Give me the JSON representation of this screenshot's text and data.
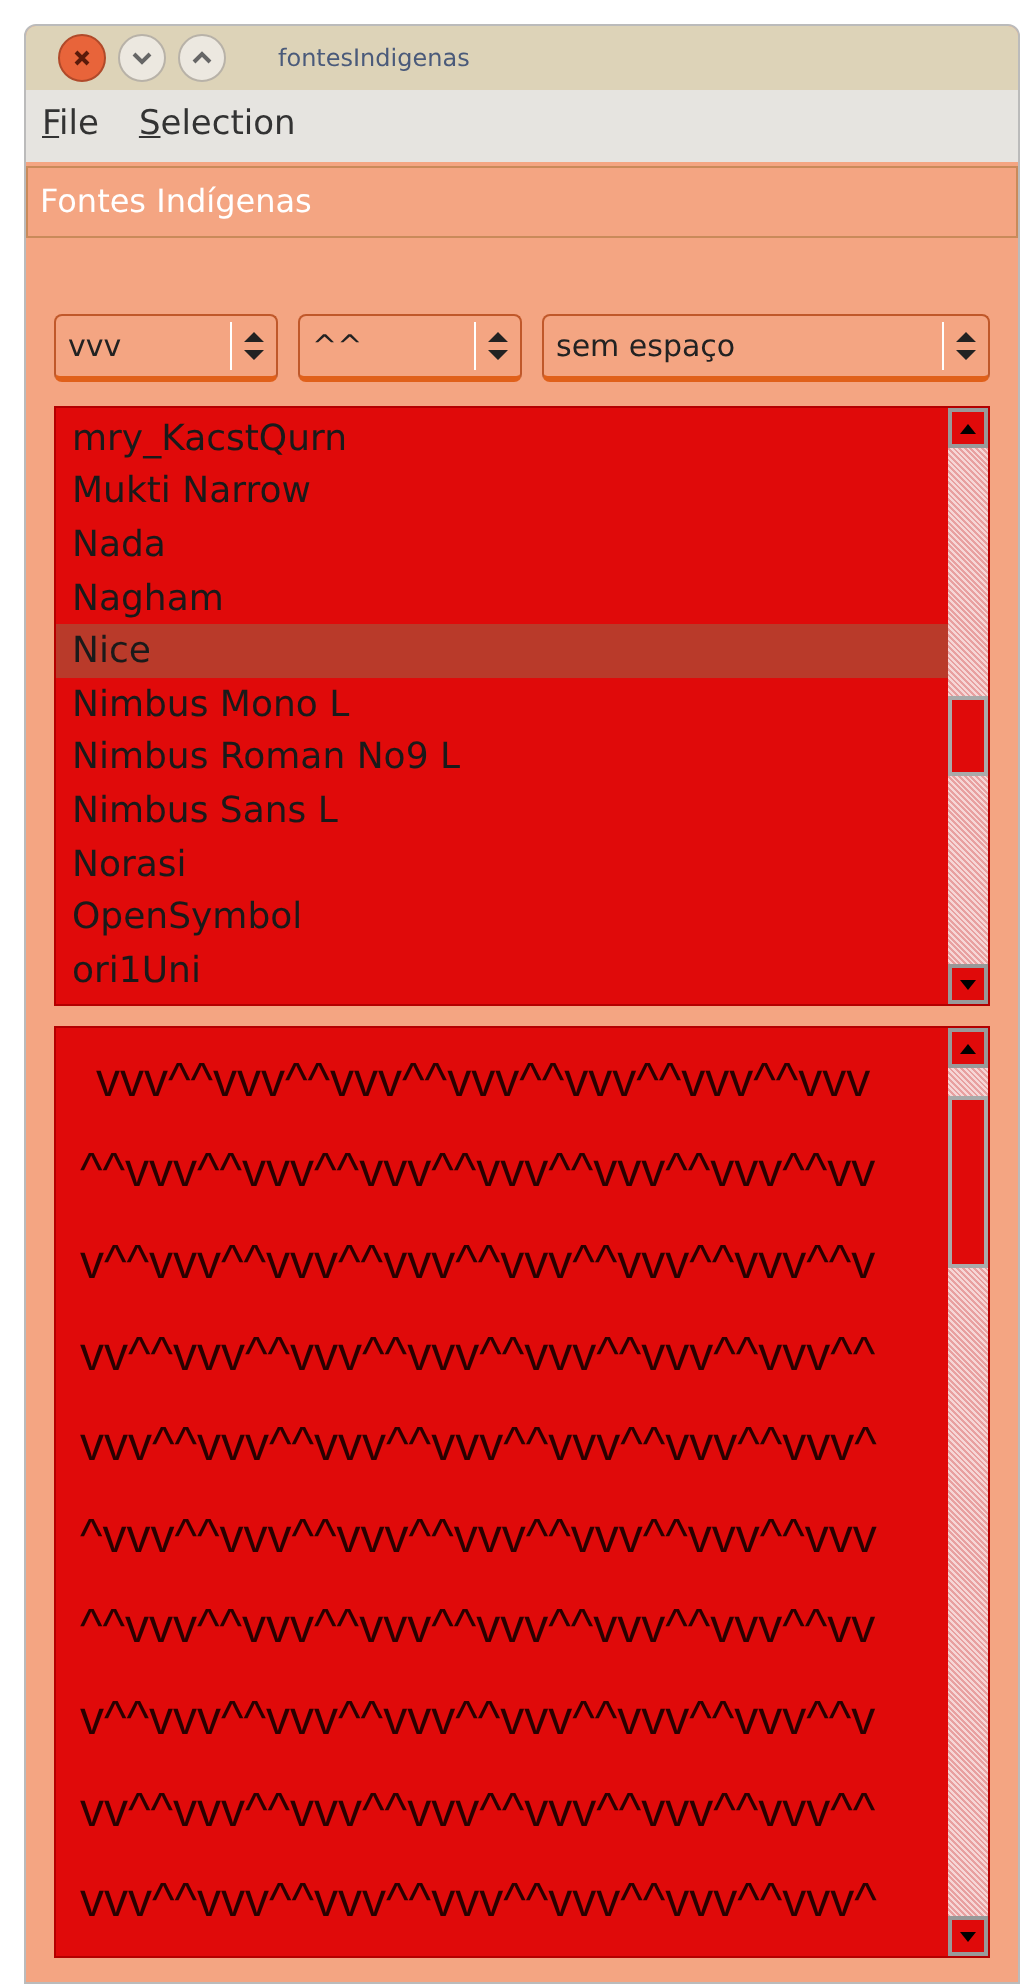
{
  "window": {
    "title": "fontesIndigenas"
  },
  "menu": [
    {
      "label": "File"
    },
    {
      "label": "Selection"
    }
  ],
  "header": {
    "value": "Fontes Indígenas"
  },
  "combos": [
    {
      "value": "vvv"
    },
    {
      "value": "^^"
    },
    {
      "value": "sem espaço"
    }
  ],
  "font_list": [
    {
      "label": "mry_KacstQurn",
      "selected": false
    },
    {
      "label": "Mukti Narrow",
      "selected": false
    },
    {
      "label": "Nada",
      "selected": false
    },
    {
      "label": "Nagham",
      "selected": false
    },
    {
      "label": "Nice",
      "selected": true
    },
    {
      "label": "Nimbus Mono L",
      "selected": false
    },
    {
      "label": "Nimbus Roman No9 L",
      "selected": false
    },
    {
      "label": "Nimbus Sans L",
      "selected": false
    },
    {
      "label": "Norasi",
      "selected": false
    },
    {
      "label": "OpenSymbol",
      "selected": false
    },
    {
      "label": "ori1Uni",
      "selected": false
    }
  ],
  "preview_lines": [
    "vvv^^vvv^^vvv^^vvv^^vvv^^vvv^^vvv",
    "^^vvv^^vvv^^vvv^^vvv^^vvv^^vvv^^vv",
    "v^^vvv^^vvv^^vvv^^vvv^^vvv^^vvv^^v",
    "vv^^vvv^^vvv^^vvv^^vvv^^vvv^^vvv^^",
    "vvv^^vvv^^vvv^^vvv^^vvv^^vvv^^vvv^",
    "^vvv^^vvv^^vvv^^vvv^^vvv^^vvv^^vvv",
    "^^vvv^^vvv^^vvv^^vvv^^vvv^^vvv^^vv",
    "v^^vvv^^vvv^^vvv^^vvv^^vvv^^vvv^^v",
    "vv^^vvv^^vvv^^vvv^^vvv^^vvv^^vvv^^",
    "vvv^^vvv^^vvv^^vvv^^vvv^^vvv^^vvv^"
  ]
}
